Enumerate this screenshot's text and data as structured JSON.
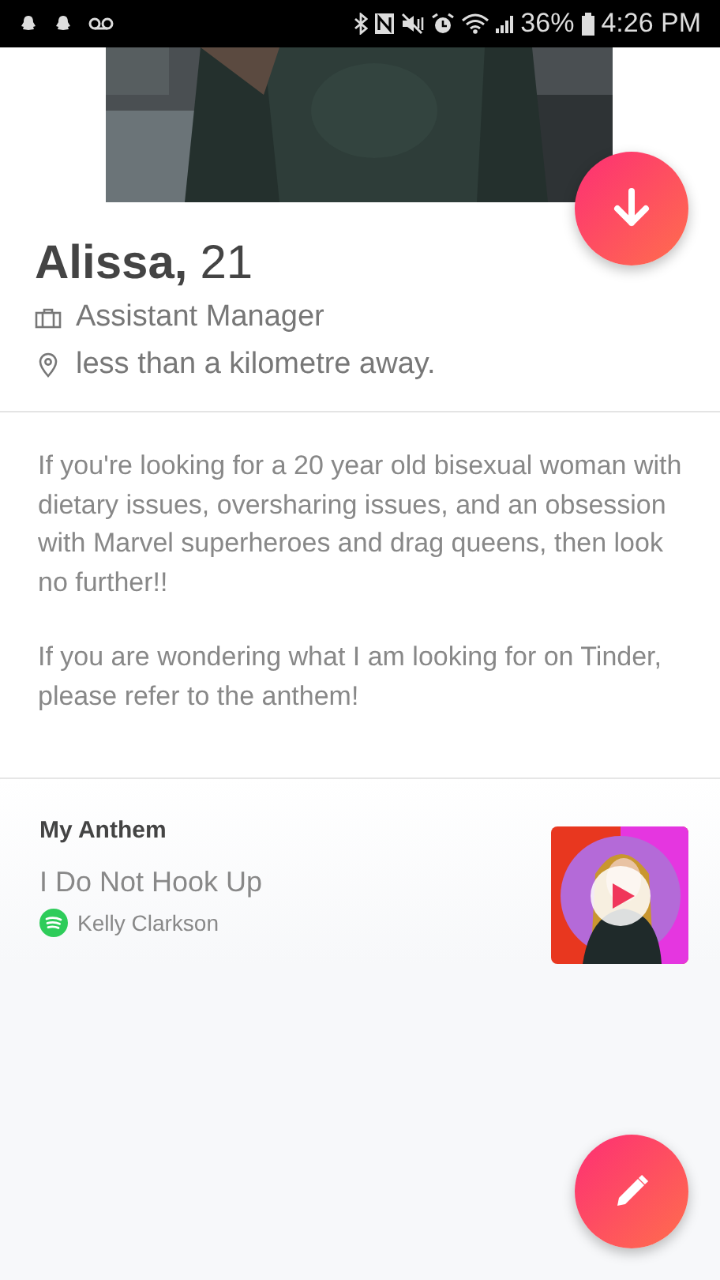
{
  "status_bar": {
    "battery": "36%",
    "time": "4:26 PM"
  },
  "profile": {
    "name": "Alissa,",
    "age": "21",
    "job": "Assistant Manager",
    "distance": "less than a kilometre away."
  },
  "bio": [
    "If you're looking for a 20 year old bisexual woman with dietary issues, oversharing issues, and an obsession with Marvel superheroes and drag queens, then look no further!!",
    "If you are wondering what I am looking for on Tinder, please refer to the anthem!"
  ],
  "anthem": {
    "heading": "My Anthem",
    "song": "I Do Not Hook Up",
    "artist": "Kelly Clarkson"
  }
}
